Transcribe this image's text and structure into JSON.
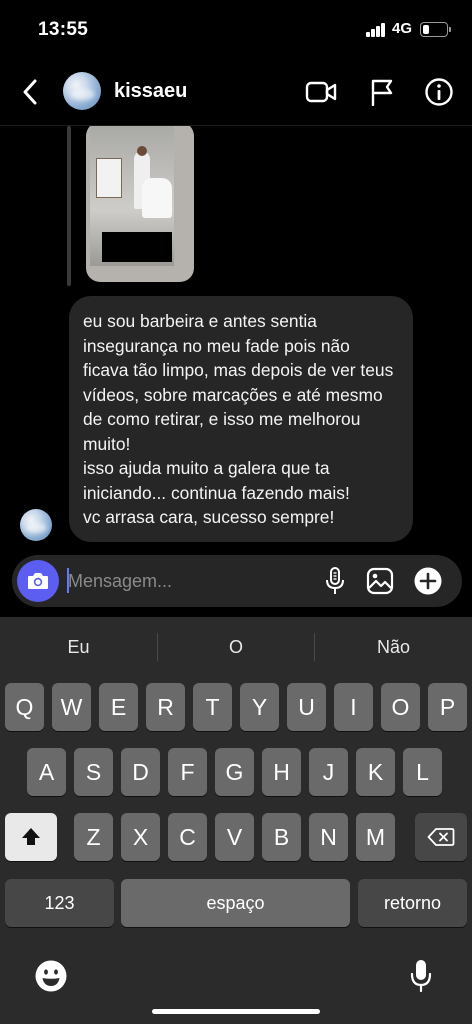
{
  "status": {
    "time": "13:55",
    "network": "4G",
    "battery_level": 0.3
  },
  "header": {
    "username": "kissaeu"
  },
  "thread": {
    "message_paragraphs": [
      "eu sou barbeira e antes sentia insegurança no meu fade pois não ficava tão limpo, mas depois de ver teus vídeos, sobre marcações e até mesmo de como retirar, e isso me melhorou muito!",
      "isso ajuda muito a galera que ta iniciando... continua fazendo mais!",
      "vc arrasa cara, sucesso sempre!"
    ]
  },
  "composer": {
    "placeholder": "Mensagem..."
  },
  "keyboard": {
    "suggestions": [
      "Eu",
      "O",
      "Não"
    ],
    "row1": [
      "Q",
      "W",
      "E",
      "R",
      "T",
      "Y",
      "U",
      "I",
      "O",
      "P"
    ],
    "row2": [
      "A",
      "S",
      "D",
      "F",
      "G",
      "H",
      "J",
      "K",
      "L"
    ],
    "row3": [
      "Z",
      "X",
      "C",
      "V",
      "B",
      "N",
      "M"
    ],
    "numbers_label": "123",
    "space_label": "espaço",
    "return_label": "retorno"
  },
  "colors": {
    "accent": "#5b5ef0",
    "bubble": "#262626",
    "key": "#6a6a6a",
    "keyboard_bg": "#2b2b2b"
  }
}
